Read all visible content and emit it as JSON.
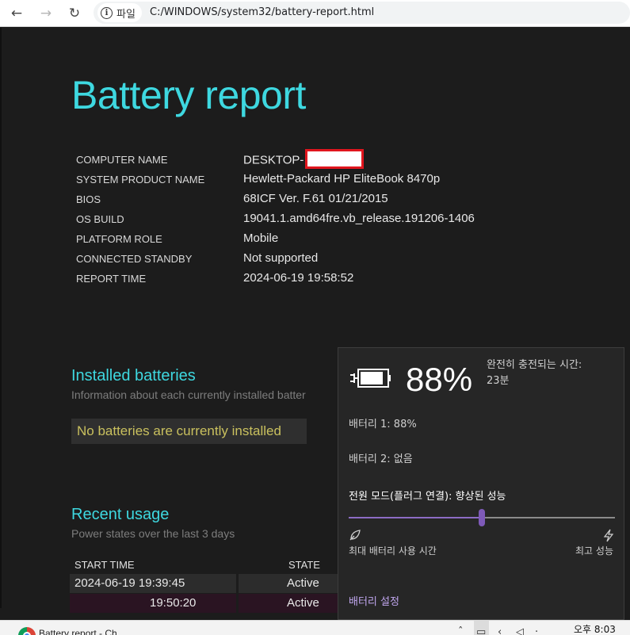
{
  "browser": {
    "chip_label": "파일",
    "url": "C:/WINDOWS/system32/battery-report.html"
  },
  "report": {
    "title": "Battery report",
    "info": [
      {
        "key": "COMPUTER NAME",
        "value": "DESKTOP-"
      },
      {
        "key": "SYSTEM PRODUCT NAME",
        "value": "Hewlett-Packard HP EliteBook 8470p"
      },
      {
        "key": "BIOS",
        "value": "68ICF Ver. F.61 01/21/2015"
      },
      {
        "key": "OS BUILD",
        "value": "19041.1.amd64fre.vb_release.191206-1406"
      },
      {
        "key": "PLATFORM ROLE",
        "value": "Mobile"
      },
      {
        "key": "CONNECTED STANDBY",
        "value": "Not supported"
      },
      {
        "key": "REPORT TIME",
        "value": "2024-06-19  19:58:52"
      }
    ],
    "installed": {
      "title": "Installed batteries",
      "subtitle": "Information about each currently installed batter",
      "message": "No batteries are currently installed"
    },
    "recent": {
      "title": "Recent usage",
      "subtitle": "Power states over the last 3 days",
      "headers": [
        "START TIME",
        "STATE"
      ],
      "rows": [
        {
          "time": "2024-06-19  19:39:45",
          "state": "Active"
        },
        {
          "time": "19:50:20",
          "state": "Active"
        }
      ]
    }
  },
  "flyout": {
    "percent": "88%",
    "charge_label": "완전히 충전되는 시간:",
    "charge_value": "23분",
    "battery1": "배터리 1: 88%",
    "battery2": "배터리 2: 없음",
    "mode_label": "전원 모드(플러그 연결): 향상된 성능",
    "slider_level": 0.5,
    "left_label": "최대 배터리 사용 시간",
    "right_label": "최고 성능",
    "settings": "배터리 설정"
  },
  "taskbar": {
    "task_label": "Battery report - Ch",
    "clock_time": "오후 8:03"
  },
  "colors": {
    "accent_cyan": "#3ed8e0",
    "warning_text": "#c9c05e",
    "slider_purple": "#7e5ab8",
    "link_purple": "#c0a6ee",
    "row_active": "#2c2c2c",
    "row_active_alt": "#2a1422"
  }
}
